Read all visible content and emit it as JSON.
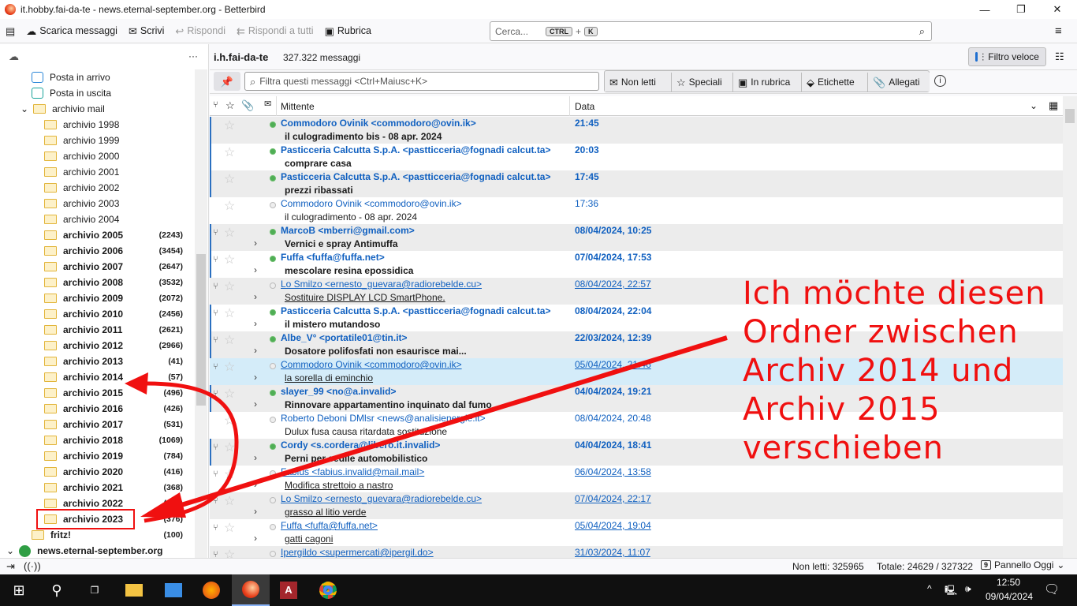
{
  "window": {
    "title": "it.hobby.fai-da-te - news.eternal-september.org - Betterbird",
    "minimize": "—",
    "maximize": "❐",
    "close": "✕"
  },
  "toolbar": {
    "get_messages": "Scarica messaggi",
    "write": "Scrivi",
    "reply": "Rispondi",
    "reply_all": "Rispondi a tutti",
    "address_book": "Rubrica",
    "search_placeholder": "Cerca...",
    "kbd_ctrl": "CTRL",
    "kbd_plus": "+",
    "kbd_k": "K"
  },
  "folders": {
    "more": "···",
    "items": [
      {
        "label": "Posta in arrivo",
        "type": "inbox",
        "count": ""
      },
      {
        "label": "Posta in uscita",
        "type": "outbox",
        "count": ""
      },
      {
        "label": "archivio mail",
        "type": "parent",
        "count": ""
      },
      {
        "label": "archivio 1998",
        "count": ""
      },
      {
        "label": "archivio 1999",
        "count": ""
      },
      {
        "label": "archivio 2000",
        "count": ""
      },
      {
        "label": "archivio 2001",
        "count": ""
      },
      {
        "label": "archivio 2002",
        "count": ""
      },
      {
        "label": "archivio 2003",
        "count": ""
      },
      {
        "label": "archivio 2004",
        "count": ""
      },
      {
        "label": "archivio 2005",
        "count": "(2243)"
      },
      {
        "label": "archivio 2006",
        "count": "(3454)"
      },
      {
        "label": "archivio 2007",
        "count": "(2647)"
      },
      {
        "label": "archivio 2008",
        "count": "(3532)"
      },
      {
        "label": "archivio 2009",
        "count": "(2072)"
      },
      {
        "label": "archivio 2010",
        "count": "(2456)"
      },
      {
        "label": "archivio 2011",
        "count": "(2621)"
      },
      {
        "label": "archivio 2012",
        "count": "(2966)"
      },
      {
        "label": "archivio 2013",
        "count": "(41)"
      },
      {
        "label": "archivio 2014",
        "count": "(57)"
      },
      {
        "label": "archivio 2015",
        "count": "(496)"
      },
      {
        "label": "archivio 2016",
        "count": "(426)"
      },
      {
        "label": "archivio 2017",
        "count": "(531)"
      },
      {
        "label": "archivio 2018",
        "count": "(1069)"
      },
      {
        "label": "archivio 2019",
        "count": "(784)"
      },
      {
        "label": "archivio 2020",
        "count": "(416)"
      },
      {
        "label": "archivio 2021",
        "count": "(368)"
      },
      {
        "label": "archivio 2022",
        "count": "(351)"
      },
      {
        "label": "archivio 2023",
        "count": "(376)"
      },
      {
        "label": "fritz!",
        "count": "(100)"
      },
      {
        "label": "news.eternal-september.org",
        "type": "account",
        "count": ""
      }
    ]
  },
  "header": {
    "folder": "i.h.fai-da-te",
    "count": "327.322 messaggi",
    "quick_filter": "Filtro veloce"
  },
  "filter": {
    "placeholder": "Filtra questi messaggi <Ctrl+Maiusc+K>",
    "unread": "Non letti",
    "starred": "Speciali",
    "contacts": "In rubrica",
    "tags": "Etichette",
    "attachments": "Allegati"
  },
  "columns": {
    "from": "Mittente",
    "date": "Data"
  },
  "messages": [
    {
      "from": "Commodoro Ovinik <commodoro@ovin.ik>",
      "subject": "il culogradimento bis - 08 apr. 2024",
      "date": "21:45",
      "unread": true,
      "thread": false,
      "underline": false
    },
    {
      "from": "Pasticceria Calcutta S.p.A. <pastticceria@fognadi calcut.ta>",
      "subject": "comprare casa",
      "date": "20:03",
      "unread": true,
      "thread": false,
      "underline": false
    },
    {
      "from": "Pasticceria Calcutta S.p.A. <pastticceria@fognadi calcut.ta>",
      "subject": "prezzi ribassati",
      "date": "17:45",
      "unread": true,
      "thread": false,
      "underline": false
    },
    {
      "from": "Commodoro Ovinik <commodoro@ovin.ik>",
      "subject": "il culogradimento - 08 apr. 2024",
      "date": "17:36",
      "unread": false,
      "thread": false,
      "underline": false
    },
    {
      "from": "MarcoB <mberri@gmail.com>",
      "subject": "Vernici e spray Antimuffa",
      "date": "08/04/2024, 10:25",
      "unread": true,
      "thread": true,
      "underline": false
    },
    {
      "from": "Fuffa <fuffa@fuffa.net>",
      "subject": "mescolare resina epossidica",
      "date": "07/04/2024, 17:53",
      "unread": true,
      "thread": true,
      "underline": false
    },
    {
      "from": "Lo Smilzo <ernesto_guevara@radiorebelde.cu>",
      "subject": "Sostituire DISPLAY LCD SmartPhone.",
      "date": "08/04/2024, 22:57",
      "unread": false,
      "thread": true,
      "underline": true
    },
    {
      "from": "Pasticceria Calcutta S.p.A. <pastticceria@fognadi calcut.ta>",
      "subject": "il mistero mutandoso",
      "date": "08/04/2024, 22:04",
      "unread": true,
      "thread": true,
      "underline": false
    },
    {
      "from": "Albe_V° <portatile01@tin.it>",
      "subject": "Dosatore polifosfati non esaurisce mai...",
      "date": "22/03/2024, 12:39",
      "unread": true,
      "thread": true,
      "underline": false
    },
    {
      "from": "Commodoro Ovinik <commodoro@ovin.ik>",
      "subject": "la sorella di eminchio",
      "date": "05/04/2024, 21:46",
      "unread": false,
      "thread": true,
      "underline": true,
      "selected": true
    },
    {
      "from": "slayer_99 <no@a.invalid>",
      "subject": "Rinnovare appartamentino inquinato dal fumo",
      "date": "04/04/2024, 19:21",
      "unread": true,
      "thread": true,
      "underline": false
    },
    {
      "from": "Roberto Deboni DMlsr <news@analisienergie.it>",
      "subject": "Dulux fusa causa ritardata sostituzione",
      "date": "08/04/2024, 20:48",
      "unread": false,
      "thread": false,
      "underline": false
    },
    {
      "from": "Cordy <s.cordera@libero.it.invalid>",
      "subject": "Perni per sedile automobilistico",
      "date": "04/04/2024, 18:41",
      "unread": true,
      "thread": true,
      "underline": false
    },
    {
      "from": "Fabius <fabius.invalid@mail.mail>",
      "subject": "Modifica strettoio a nastro",
      "date": "06/04/2024, 13:58",
      "unread": false,
      "thread": true,
      "underline": true
    },
    {
      "from": "Lo Smilzo <ernesto_guevara@radiorebelde.cu>",
      "subject": "grasso al litio verde",
      "date": "07/04/2024, 22:17",
      "unread": false,
      "thread": true,
      "underline": true
    },
    {
      "from": "Fuffa <fuffa@fuffa.net>",
      "subject": "gatti cagoni",
      "date": "05/04/2024, 19:04",
      "unread": false,
      "thread": true,
      "underline": true
    },
    {
      "from": "Ipergildo <supermercati@ipergil.do>",
      "subject": "",
      "date": "31/03/2024, 11:07",
      "unread": false,
      "thread": true,
      "underline": true
    }
  ],
  "status": {
    "unread": "Non letti: 325965",
    "total": "Totale: 24629 / 327322",
    "today_pane": "Pannello Oggi",
    "calendar_day": "9"
  },
  "taskbar": {
    "time": "12:50",
    "date": "09/04/2024"
  },
  "annotation": {
    "lines": [
      "Ich möchte diesen",
      "Ordner zwischen",
      "Archiv 2014 und",
      "Archiv 2015",
      "verschieben"
    ],
    "color": "#f01010"
  }
}
